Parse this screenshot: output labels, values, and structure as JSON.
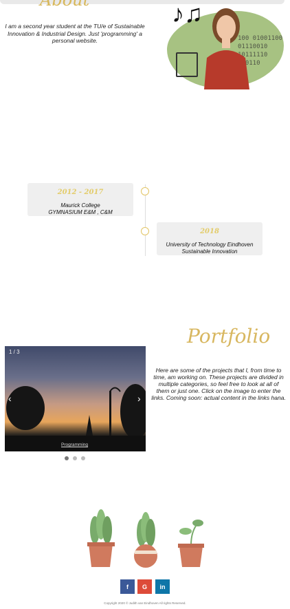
{
  "about": {
    "heading_script": "About",
    "intro": "I am a second year student at the TU/e of Sustainable Innovation & Industrial Design. Just 'programming' a personal website."
  },
  "hero": {
    "binary_lines": [
      "100 01001100",
      "01110010",
      "10111110",
      "010110"
    ]
  },
  "timeline": {
    "items": [
      {
        "year": "2012 - 2017",
        "school": "Maurick College",
        "detail": "GYMNASIUM E&M , C&M"
      },
      {
        "year": "2018",
        "school": "University of Technology Eindhoven",
        "detail": "Sustainable Innovation"
      }
    ]
  },
  "portfolio": {
    "title": "Portfolio",
    "description": "Here are some of the projects that I, from time to time, am working on. These projects are divided in multiple categories, so feel free to look at all of them or just one. Click on the image to enter the links. Coming soon: actual content in the links hana.",
    "carousel": {
      "counter": "1 / 3",
      "caption": "Programming",
      "prev_glyph": "‹",
      "next_glyph": "›",
      "active_index": 0,
      "dots": 3
    }
  },
  "social": {
    "facebook": "f",
    "google": "G",
    "linkedin": "in"
  },
  "footer": {
    "copyright": "Copyright 2020 © Judith van Eindhoven All rights Reserved."
  },
  "colors": {
    "accent_gold": "#d8b760",
    "blob_green": "#a7c282",
    "facebook": "#3b5998",
    "google": "#dd4b39",
    "linkedin": "#0e76a8",
    "pot": "#d07a5e",
    "leaf": "#79ab6b"
  }
}
